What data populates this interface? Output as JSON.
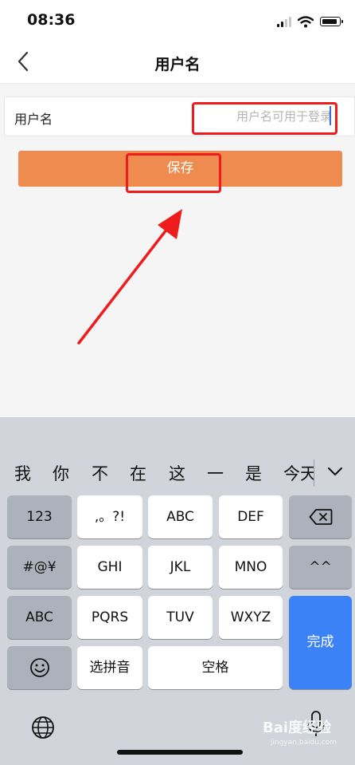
{
  "status_bar": {
    "time": "08:36"
  },
  "nav": {
    "title": "用户名"
  },
  "form": {
    "label": "用户名",
    "value": "",
    "placeholder": "用户名可用于登录"
  },
  "save_button": {
    "label": "保存"
  },
  "keyboard": {
    "candidates": [
      "我",
      "你",
      "不",
      "在",
      "这",
      "一",
      "是"
    ],
    "candidate_clipped": "今天",
    "keys": {
      "num": "123",
      "punct": ",。?!",
      "abc": "ABC",
      "def": "DEF",
      "symbols": "#@¥",
      "ghi": "GHI",
      "jkl": "JKL",
      "mno": "MNO",
      "emoticon": "^^",
      "abc_mode": "ABC",
      "pqrs": "PQRS",
      "tuv": "TUV",
      "wxyz": "WXYZ",
      "done": "完成",
      "pinyin": "选拼音",
      "space": "空格"
    }
  },
  "watermark": {
    "brand": "Bai度经验",
    "url": "jingyan.baidu.com"
  },
  "colors": {
    "accent_orange": "#ef8b4e",
    "highlight_red": "#ee1c1c",
    "done_blue": "#3b82f6"
  }
}
